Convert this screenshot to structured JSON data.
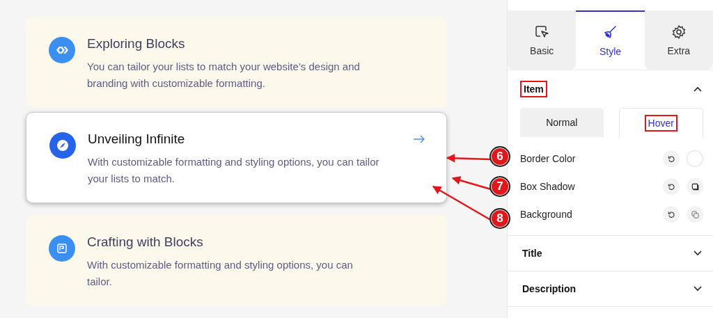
{
  "cards": [
    {
      "title": "Exploring Blocks",
      "description": "You can tailor your lists to match your website’s design and branding with customizable formatting.",
      "hovered": false
    },
    {
      "title": "Unveiling Infinite",
      "description": "With customizable formatting and styling options, you can tailor your lists to match.",
      "hovered": true
    },
    {
      "title": "Crafting with Blocks",
      "description": "With customizable formatting and styling options, you can tailor.",
      "hovered": false
    }
  ],
  "panel": {
    "tabs": [
      {
        "label": "Basic",
        "selected": false
      },
      {
        "label": "Style",
        "selected": true
      },
      {
        "label": "Extra",
        "selected": false
      }
    ],
    "sections": [
      {
        "title": "Item",
        "expanded": true,
        "highlighted": true,
        "state_tabs": [
          {
            "label": "Normal",
            "selected": false,
            "highlighted": false
          },
          {
            "label": "Hover",
            "selected": true,
            "highlighted": true
          }
        ],
        "controls": [
          {
            "label": "Border Color",
            "kind": "color"
          },
          {
            "label": "Box Shadow",
            "kind": "shadow"
          },
          {
            "label": "Background",
            "kind": "background"
          }
        ]
      },
      {
        "title": "Title",
        "expanded": false,
        "highlighted": false
      },
      {
        "title": "Description",
        "expanded": false,
        "highlighted": false
      }
    ]
  },
  "callouts": [
    "6",
    "7",
    "8"
  ]
}
